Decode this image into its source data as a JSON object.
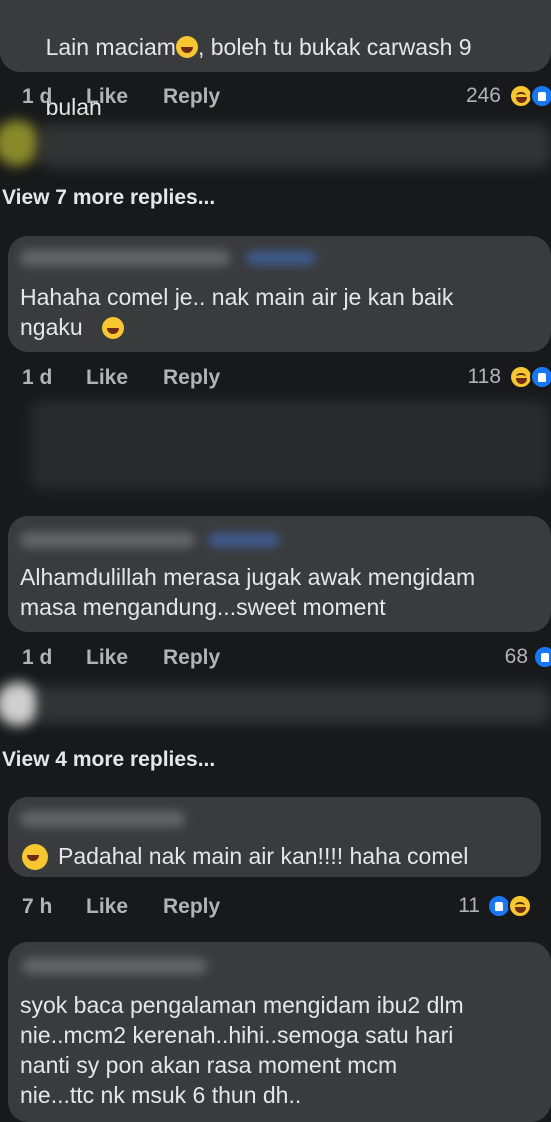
{
  "comments": [
    {
      "text_line1": "Lain maciam",
      "text_line1_rest": ", boleh tu bukak carwash 9",
      "text_line2": "bulan",
      "time": "1 d",
      "like": "Like",
      "reply": "Reply",
      "count": "246"
    },
    {
      "text": "Hahaha comel je.. nak main air je kan baik\nngaku",
      "time": "1 d",
      "like": "Like",
      "reply": "Reply",
      "count": "118"
    },
    {
      "text": "Alhamdulillah merasa jugak awak mengidam\nmasa mengandung...sweet moment",
      "time": "1 d",
      "like": "Like",
      "reply": "Reply",
      "count": "68"
    },
    {
      "text": "Padahal nak main air kan!!!! haha comel",
      "time": "7 h",
      "like": "Like",
      "reply": "Reply",
      "count": "11"
    },
    {
      "text": "syok baca pengalaman mengidam ibu2 dlm\nnie..mcm2 kerenah..hihi..semoga satu hari\nnanti sy pon akan rasa moment mcm\nnie...ttc nk msuk 6 thun dh.."
    }
  ],
  "view_more_1": "View 7 more replies...",
  "view_more_2": "View 4 more replies...",
  "colors": {
    "background": "#18191a",
    "bubble": "#3a3b3c",
    "text": "#e4e6eb",
    "meta": "#b0b3b8",
    "like_blue": "#1877f2",
    "haha_yellow": "#f7c631"
  },
  "icons": [
    "haha-reaction-icon",
    "like-reaction-icon",
    "laughing-emoji-icon",
    "grinning-emoji-icon"
  ]
}
